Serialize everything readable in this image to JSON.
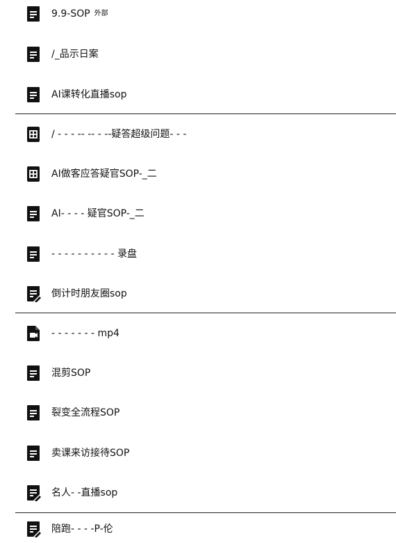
{
  "colors": {
    "icon_fill": "#111111",
    "icon_glyph": "#ffffff",
    "text": "#111111",
    "divider": "#222222"
  },
  "files": [
    {
      "name": "9.9-SOP",
      "tag": "外部",
      "icon": "doc-icon"
    },
    {
      "name": "/_品示日案",
      "tag": "",
      "icon": "doc-icon"
    },
    {
      "name": "AI课转化直播sop",
      "tag": "",
      "icon": "doc-icon"
    },
    {
      "name": "/ - - - -- -- - --疑答超级问题- - -",
      "tag": "",
      "icon": "table-icon"
    },
    {
      "name": "AI做客应答疑官SOP-_二",
      "tag": "",
      "icon": "table-icon"
    },
    {
      "name": "AI- - - - 疑官SOP-_二",
      "tag": "",
      "icon": "doc-icon"
    },
    {
      "name": "- - - - - - - - - - 录盘",
      "tag": "",
      "icon": "doc-icon"
    },
    {
      "name": "倒计时朋友圈sop",
      "tag": "",
      "icon": "doc-pen-icon"
    },
    {
      "name": "- - - - - - - mp4",
      "tag": "",
      "icon": "video-icon"
    },
    {
      "name": "混剪SOP",
      "tag": "",
      "icon": "doc-icon"
    },
    {
      "name": "裂变全流程SOP",
      "tag": "",
      "icon": "doc-icon"
    },
    {
      "name": "卖课来访接待SOP",
      "tag": "",
      "icon": "doc-icon"
    },
    {
      "name": "名人- -直播sop",
      "tag": "",
      "icon": "doc-pen-icon"
    },
    {
      "name": "陪跑- - - -P-伦",
      "tag": "",
      "icon": "doc-pen-icon"
    }
  ]
}
